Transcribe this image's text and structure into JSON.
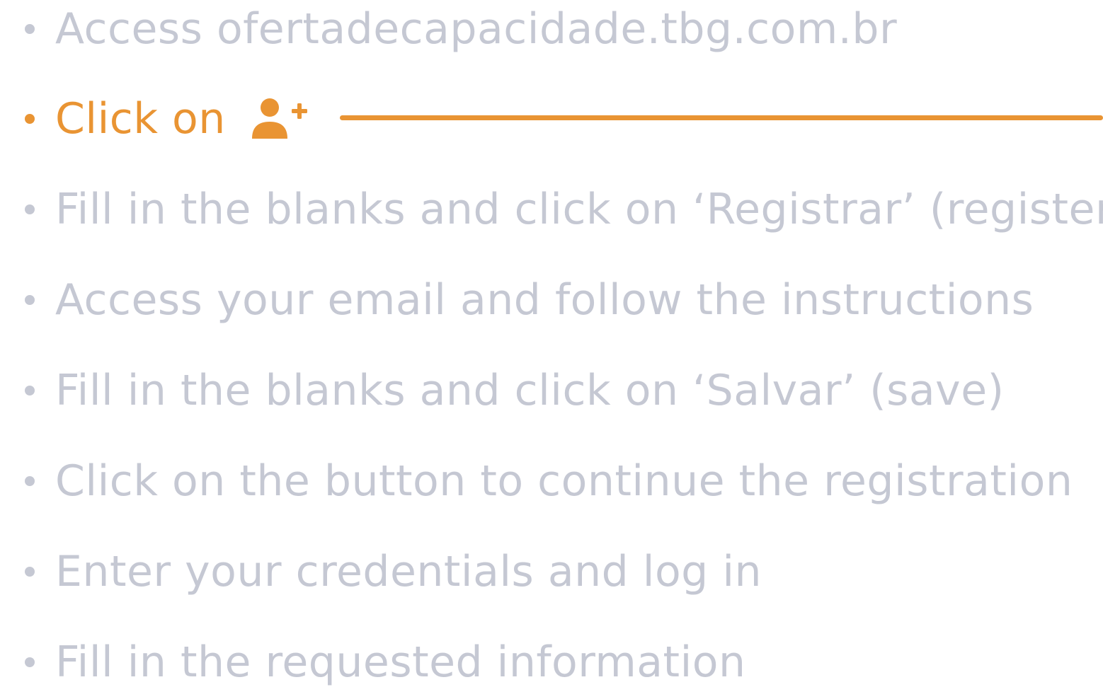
{
  "colors": {
    "muted": "#c5c8d3",
    "accent": "#e99433"
  },
  "steps": [
    {
      "text": "Access ofertadecapacidade.tbg.com.br"
    },
    {
      "text": "Click on",
      "icon": "user-plus-icon"
    },
    {
      "text": "Fill in the blanks and click on ‘Registrar’ (register)"
    },
    {
      "text": "Access your email and follow the instructions"
    },
    {
      "text": "Fill in the blanks and click on ‘Salvar’ (save)"
    },
    {
      "text": "Click on the button to continue the registration"
    },
    {
      "text": "Enter your credentials and log in"
    },
    {
      "text": "Fill in the requested information"
    }
  ]
}
